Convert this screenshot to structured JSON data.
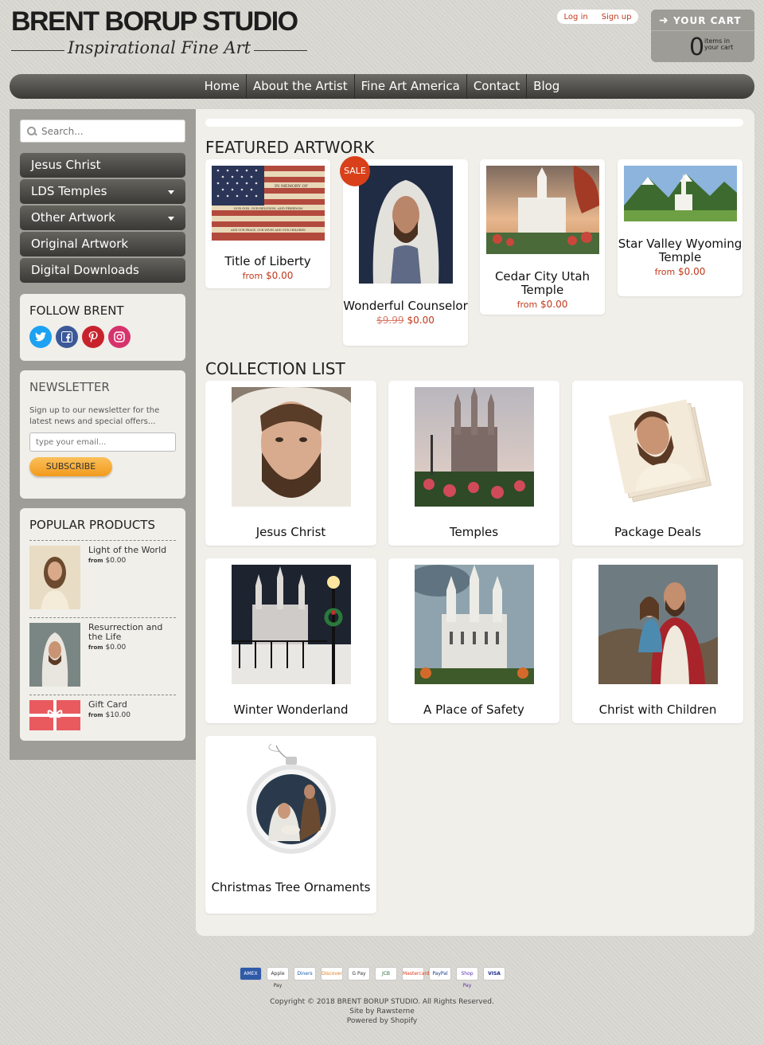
{
  "header": {
    "logo_title": "BRENT BORUP STUDIO",
    "logo_subtitle": "Inspirational Fine Art",
    "login": "Log in",
    "signup": "Sign up",
    "cart_label": "YOUR CART",
    "cart_count": "0",
    "cart_items_text": "items in your cart"
  },
  "nav": [
    "Home",
    "About the Artist",
    "Fine Art America",
    "Contact",
    "Blog"
  ],
  "sidebar": {
    "search_placeholder": "Search...",
    "categories": [
      "Jesus Christ",
      "LDS Temples",
      "Other Artwork",
      "Original Artwork",
      "Digital Downloads"
    ],
    "follow_title": "FOLLOW BRENT",
    "social": [
      "twitter-icon",
      "facebook-icon",
      "pinterest-icon",
      "instagram-icon"
    ],
    "newsletter": {
      "title": "NEWSLETTER",
      "text": "Sign up to our newsletter for the latest news and special offers...",
      "placeholder": "type your email...",
      "button": "SUBSCRIBE"
    },
    "popular": {
      "title": "POPULAR PRODUCTS",
      "items": [
        {
          "name": "Light of the World",
          "from": "from",
          "price": "$0.00"
        },
        {
          "name": "Resurrection and the Life",
          "from": "from",
          "price": "$0.00"
        },
        {
          "name": "Gift Card",
          "from": "from",
          "price": "$10.00"
        }
      ]
    }
  },
  "featured": {
    "title": "FEATURED ARTWORK",
    "items": [
      {
        "title": "Title of Liberty",
        "from": "from",
        "price": "$0.00"
      },
      {
        "title": "Wonderful Counselor",
        "old_price": "$9.99",
        "price": "$0.00",
        "badge": "SALE"
      },
      {
        "title": "Cedar City Utah Temple",
        "from": "from",
        "price": "$0.00"
      },
      {
        "title": "Star Valley Wyoming Temple",
        "from": "from",
        "price": "$0.00"
      }
    ],
    "flag_text_1": "IN MEMORY OF",
    "flag_text_2": "OUR GOD, OUR RELIGION, AND FREEDOM",
    "flag_text_3": "AND OUR PEACE, OUR WIVES AND OUR CHILDREN"
  },
  "collections": {
    "title": "COLLECTION LIST",
    "items": [
      "Jesus Christ",
      "Temples",
      "Package Deals",
      "Winter Wonderland",
      "A Place of Safety",
      "Christ with Children",
      "Christmas Tree Ornaments"
    ]
  },
  "footer": {
    "payments": [
      "AMEX",
      "Apple Pay",
      "Diners",
      "Discover",
      "G Pay",
      "JCB",
      "Mastercard",
      "PayPal",
      "Shop Pay",
      "VISA"
    ],
    "copyright": "Copyright © 2018 BRENT BORUP STUDIO. All Rights Reserved.",
    "site_by": "Site by Rawsterne",
    "powered": "Powered by Shopify"
  },
  "colors": {
    "accent": "#c0391b",
    "sale": "#d9401a",
    "nav": "#4a4945",
    "subscribe": "#f5a623"
  }
}
